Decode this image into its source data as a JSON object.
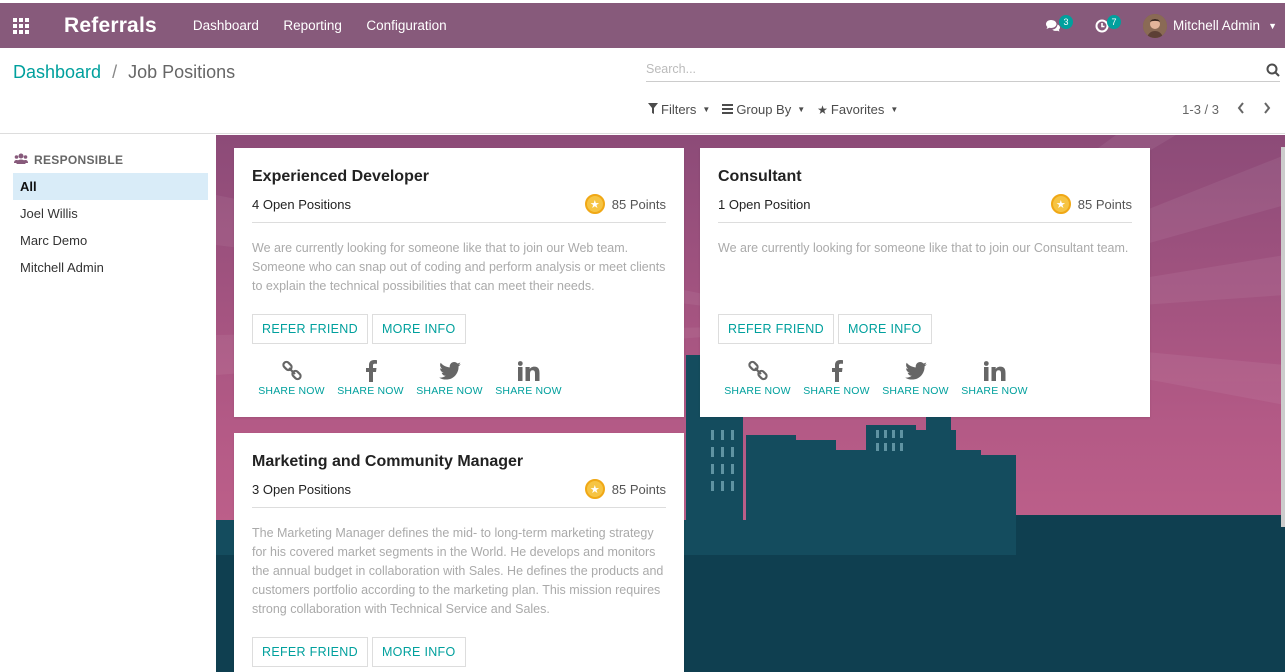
{
  "navbar": {
    "brand": "Referrals",
    "menu": [
      "Dashboard",
      "Reporting",
      "Configuration"
    ],
    "messages_count": "3",
    "activities_count": "7",
    "user_name": "Mitchell Admin"
  },
  "breadcrumb": {
    "parent": "Dashboard",
    "separator": "/",
    "current": "Job Positions"
  },
  "search": {
    "placeholder": "Search..."
  },
  "filters": {
    "filters_label": "Filters",
    "groupby_label": "Group By",
    "favorites_label": "Favorites"
  },
  "pager": {
    "value": "1-3 / 3"
  },
  "side": {
    "title": "RESPONSIBLE",
    "items": [
      "All",
      "Joel Willis",
      "Marc Demo",
      "Mitchell Admin"
    ]
  },
  "cards": [
    {
      "title": "Experienced Developer",
      "positions": "4 Open Positions",
      "points": "85 Points",
      "description": "We are currently looking for someone like that to join our Web team. Someone who can snap out of coding and perform analysis or meet clients to explain the technical possibilities that can meet their needs."
    },
    {
      "title": "Consultant",
      "positions": "1 Open Position",
      "points": "85 Points",
      "description": "We are currently looking for someone like that to join our Consultant team."
    },
    {
      "title": "Marketing and Community Manager",
      "positions": "3 Open Positions",
      "points": "85 Points",
      "description": "The Marketing Manager defines the mid- to long-term marketing strategy for his covered market segments in the World. He develops and monitors the annual budget in collaboration with Sales. He defines the products and customers portfolio according to the marketing plan. This mission requires strong collaboration with Technical Service and Sales."
    }
  ],
  "card_buttons": {
    "refer": "REFER FRIEND",
    "more": "MORE INFO"
  },
  "share_label": "SHARE NOW",
  "colors": {
    "brand": "#875a7b",
    "accent": "#00a09d",
    "coin": "#f6c443"
  }
}
